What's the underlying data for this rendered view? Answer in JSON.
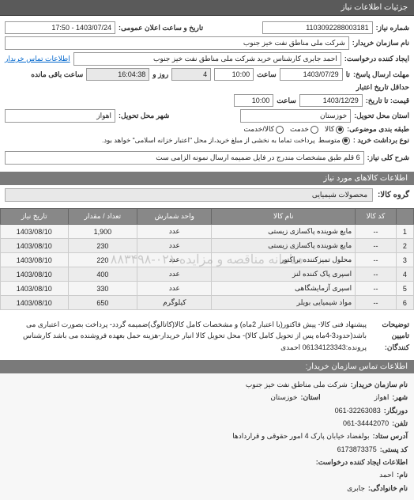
{
  "headers": {
    "main": "جزئیات اطلاعات نیاز",
    "goods_info": "اطلاعات کالاهای مورد نیاز",
    "contact": "اطلاعات تماس سازمان خریدار:"
  },
  "form": {
    "req_no_label": "شماره نیاز:",
    "req_no": "1103092288003181",
    "announce_label": "تاریخ و ساعت اعلان عمومی:",
    "announce_value": "1403/07/24 - 17:50",
    "buyer_label": "نام سازمان خریدار:",
    "buyer_value": "شرکت ملی مناطق نفت خیز جنوب",
    "creator_label": "ایجاد کننده درخواست:",
    "creator_value": "احمد جابری کارشناس خرید شرکت ملی مناطق نفت خیز جنوب",
    "buyer_contact_link": "اطلاعات تماس خریدار",
    "deadline_label": "مهلت ارسال پاسخ:",
    "deadline_to": "تا",
    "deadline_date": "1403/07/29",
    "deadline_time_label": "ساعت",
    "deadline_time": "10:00",
    "remain_days": "4",
    "remain_days_label": "روز و",
    "remain_time": "16:04:38",
    "remain_suffix": "ساعت باقی مانده",
    "validity_min_label": "حداقل تاریخ اعتبار",
    "validity_label": "قیمت: تا تاریخ:",
    "validity_date": "1403/12/29",
    "validity_time_label": "ساعت",
    "validity_time": "10:00",
    "province_label": "استان محل تحویل:",
    "province_value": "خوزستان",
    "city_label": "شهر محل تحویل:",
    "city_value": "اهواز",
    "packaging_label": "طبقه بندی موضوعی:",
    "pkg_opt1": "کالا",
    "pkg_opt2": "خدمت",
    "pkg_opt3": "کالا/خدمت",
    "payment_label": "نوع برداشت خرید :",
    "payment_opt1": "متوسط",
    "payment_note": "پرداخت تماما به نخشی از مبلغ خرید،از محل \"اعتبار خزانه اسلامی\" خواهد بود.",
    "general_title_label": "شرح کلی نیاز:",
    "general_title_value": "6 قلم طبق مشخصات مندرج در فایل ضمیمه ارسال نمونه الزامی ست",
    "group_label": "گروه کالا:",
    "group_value": "محصولات شیمیایی",
    "desc_label": "توضیحات\nتامیین\nکنندگان:",
    "desc_text": "پیشنهاد فنی کالا- پیش فاکتور(با اعتبار 2ماه) و مشخصات کامل کالا(کاتالوگ)ضمیمه گردد- پرداخت بصورت اعتباری می باشد(حدود3-4ماه پس از تحویل کامل کالا)- محل تحویل کالا انبار خریدار-هزینه حمل بعهده فروشنده می باشد کارشناس پرونده:06134123343 احمدی"
  },
  "table": {
    "cols": {
      "row": "",
      "code": "کد کالا",
      "name": "نام کالا",
      "unit": "واحد شمارش",
      "qty": "تعداد / مقدار",
      "date": "تاریخ نیاز"
    },
    "rows": [
      {
        "n": "1",
        "code": "--",
        "name": "مایع شوینده پاکسازی زیستی",
        "unit": "عدد",
        "qty": "1,900",
        "date": "1403/08/10"
      },
      {
        "n": "2",
        "code": "--",
        "name": "مایع شوینده پاکسازی زیستی",
        "unit": "عدد",
        "qty": "230",
        "date": "1403/08/10"
      },
      {
        "n": "3",
        "code": "--",
        "name": "محلول تمیزکننده تراکتور",
        "unit": "عدد",
        "qty": "220",
        "date": "1403/08/10"
      },
      {
        "n": "4",
        "code": "--",
        "name": "اسپری پاک کننده لنز",
        "unit": "عدد",
        "qty": "400",
        "date": "1403/08/10"
      },
      {
        "n": "5",
        "code": "--",
        "name": "اسپری آزمایشگاهی",
        "unit": "عدد",
        "qty": "330",
        "date": "1403/08/10"
      },
      {
        "n": "6",
        "code": "--",
        "name": "مواد شیمیایی بویلر",
        "unit": "کیلوگرم",
        "qty": "650",
        "date": "1403/08/10"
      }
    ]
  },
  "watermark": "سامانه مناقصه و مزایده ۰۲۱-۸۸۳۴۹۸",
  "contact": {
    "org_label": "نام سازمان خریدار:",
    "org_value": "شرکت ملی مناطق نفت خیز جنوب",
    "city_label": "شهر:",
    "city_value": "اهواز",
    "province_label": "استان:",
    "province_value": "خوزستان",
    "fax_label": "دورنگار:",
    "fax_value": "061-32263083",
    "phone_label": "تلفن:",
    "phone_value": "061-34442070",
    "address_label": "آدرس ستاد:",
    "address_value": "بولفضاد خیابان پارک 4 امور حقوقی و قراردادها",
    "postal_label": "کد پستی:",
    "postal_value": "6173873375",
    "creator_label": "اطلاعات ایجاد کننده درخواست:",
    "name_label": "نام:",
    "name_value": "احمد",
    "lname_label": "نام خانوادگی:",
    "lname_value": "جابری"
  }
}
